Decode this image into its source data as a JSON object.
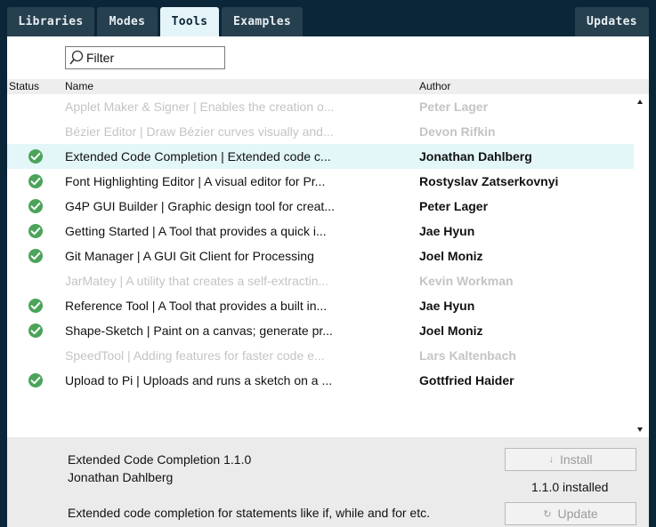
{
  "tabs": [
    {
      "label": "Libraries",
      "active": false
    },
    {
      "label": "Modes",
      "active": false
    },
    {
      "label": "Tools",
      "active": true
    },
    {
      "label": "Examples",
      "active": false
    },
    {
      "label": "Updates",
      "active": false
    }
  ],
  "filter": {
    "placeholder": "Filter",
    "value": ""
  },
  "columns": {
    "status": "Status",
    "name": "Name",
    "author": "Author"
  },
  "rows": [
    {
      "name": "Applet Maker & Signer | Enables the creation o...",
      "author": "Peter Lager",
      "status": "incompatible"
    },
    {
      "name": "Bézier Editor | Draw Bézier curves visually and...",
      "author": "Devon Rifkin",
      "status": "incompatible"
    },
    {
      "name": "Extended Code Completion | Extended code c...",
      "author": "Jonathan Dahlberg",
      "status": "installed"
    },
    {
      "name": "Font Highlighting Editor | A visual editor for Pr...",
      "author": "Rostyslav Zatserkovnyi",
      "status": "installed"
    },
    {
      "name": "G4P GUI Builder | Graphic design tool for creat...",
      "author": "Peter Lager",
      "status": "installed"
    },
    {
      "name": "Getting Started | A Tool that provides a quick i...",
      "author": "Jae Hyun",
      "status": "installed"
    },
    {
      "name": "Git Manager | A GUI Git Client for Processing",
      "author": "Joel Moniz",
      "status": "installed"
    },
    {
      "name": "JarMatey | A utility that creates a self-extractin...",
      "author": "Kevin Workman",
      "status": "incompatible"
    },
    {
      "name": "Reference Tool | A Tool that provides a built in...",
      "author": "Jae Hyun",
      "status": "installed"
    },
    {
      "name": "Shape-Sketch | Paint on a canvas; generate pr...",
      "author": "Joel Moniz",
      "status": "installed"
    },
    {
      "name": "SpeedTool | Adding features for faster code e...",
      "author": "Lars Kaltenbach",
      "status": "incompatible"
    },
    {
      "name": "Upload to Pi | Uploads and runs a sketch on a ...",
      "author": "Gottfried Haider",
      "status": "installed"
    }
  ],
  "selected_row": 2,
  "detail": {
    "title": "Extended Code Completion 1.1.0",
    "author": "Jonathan Dahlberg",
    "description": "Extended code completion for statements like if, while and for etc.",
    "installed_text": "1.1.0 installed",
    "install_label": "Install",
    "update_label": "Update"
  },
  "colors": {
    "background": "#0b2638",
    "tab": "#27404f",
    "tab_active": "#e4f4f9",
    "check_green": "#4ca35a",
    "selected_row": "#e3f6f8"
  }
}
